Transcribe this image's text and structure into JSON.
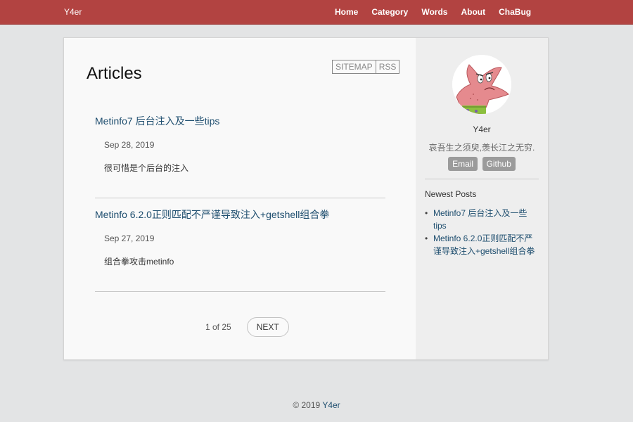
{
  "header": {
    "brand": "Y4er",
    "nav": [
      "Home",
      "Category",
      "Words",
      "About",
      "ChaBug"
    ]
  },
  "main": {
    "title": "Articles",
    "top_links": [
      "SITEMAP",
      "RSS"
    ],
    "posts": [
      {
        "title": "Metinfo7 后台注入及一些tips",
        "date": "Sep 28, 2019",
        "excerpt": "很可惜是个后台的注入"
      },
      {
        "title": "Metinfo 6.2.0正则匹配不严谨导致注入+getshell组合拳",
        "date": "Sep 27, 2019",
        "excerpt": "组合拳攻击metinfo"
      }
    ],
    "pager": {
      "info": "1 of 25",
      "next_label": "NEXT"
    }
  },
  "sidebar": {
    "avatar_icon": "patrick-star-avatar",
    "author": "Y4er",
    "motto": "哀吾生之须臾,羡长江之无穷.",
    "social": [
      "Email",
      "Github"
    ],
    "newest_title": "Newest Posts",
    "newest": [
      "Metinfo7 后台注入及一些tips",
      "Metinfo 6.2.0正则匹配不严谨导致注入+getshell组合拳"
    ]
  },
  "footer": {
    "copyright": "© 2019",
    "author": "Y4er"
  },
  "colors": {
    "header": "#b24341",
    "link": "#1d4d6e",
    "background": "#e3e4e5"
  }
}
